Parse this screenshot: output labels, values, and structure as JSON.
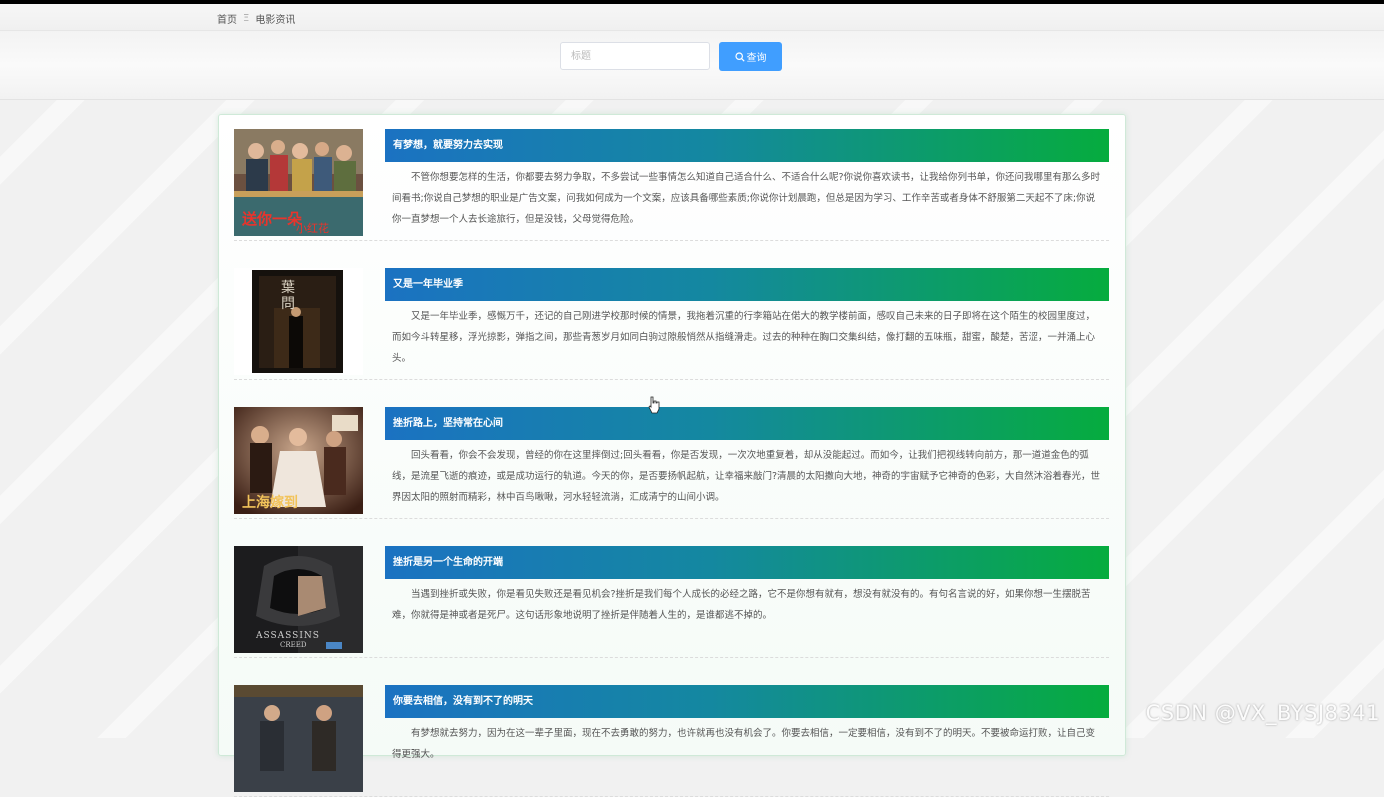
{
  "breadcrumb": {
    "home": "首页",
    "separator": "Ξ",
    "current": "电影资讯"
  },
  "search": {
    "placeholder": "标题",
    "value": "",
    "button_label": "查询",
    "button_icon": "search-icon"
  },
  "articles": [
    {
      "title": "有梦想，就要努力去实现",
      "text": "不管你想要怎样的生活，你都要去努力争取，不多尝试一些事情怎么知道自己适合什么、不适合什么呢?你说你喜欢读书，让我给你列书单，你还问我哪里有那么多时间看书;你说自己梦想的职业是广告文案，问我如何成为一个文案，应该具备哪些素质;你说你计划晨跑，但总是因为学习、工作辛苦或者身体不舒服第二天起不了床;你说你一直梦想一个人去长途旅行，但是没钱，父母觉得危险。",
      "poster_caption": "送你一朵小红花"
    },
    {
      "title": "又是一年毕业季",
      "text": "又是一年毕业季，感慨万千，还记的自己刚进学校那时候的情景，我拖着沉重的行李箱站在偌大的教学楼前面，感叹自己未来的日子即将在这个陌生的校园里度过，而如今斗转星移，浮光掠影，弹指之间，那些青葱岁月如同白驹过隙般悄然从指缝滑走。过去的种种在胸口交集纠结，像打翻的五味瓶，甜蜜，酸楚，苦涩，一并涌上心头。",
      "poster_caption": "葉問"
    },
    {
      "title": "挫折路上，坚持常在心间",
      "text": "回头看看，你会不会发现，曾经的你在这里摔倒过;回头看看，你是否发现，一次次地重复着，却从没能起过。而如今，让我们把视线转向前方，那一道道金色的弧线，是流星飞逝的痕迹，或是成功运行的轨道。今天的你，是否要扬帆起航，让幸福来敲门?清晨的太阳撒向大地，神奇的宇宙赋予它神奇的色彩，大自然沐浴着春光，世界因太阳的照射而精彩，林中百鸟啾啾，河水轻轻流淌，汇成清宁的山间小调。",
      "poster_caption": "上海嫁到"
    },
    {
      "title": "挫折是另一个生命的开端",
      "text": "当遇到挫折或失败，你是看见失败还是看见机会?挫折是我们每个人成长的必经之路，它不是你想有就有，想没有就没有的。有句名言说的好，如果你想一生摆脱苦难，你就得是神或者是死尸。这句话形象地说明了挫折是伴随着人生的，是谁都逃不掉的。",
      "poster_caption": "ASSASSINS CREED"
    },
    {
      "title": "你要去相信，没有到不了的明天",
      "text": "有梦想就去努力，因为在这一辈子里面，现在不去勇敢的努力，也许就再也没有机会了。你要去相信，一定要相信，没有到不了的明天。不要被命运打败，让自己变得更强大。",
      "poster_caption": ""
    }
  ],
  "watermark": "CSDN @VX_BYSJ8341",
  "colors": {
    "title_gradient_start": "#1b72c2",
    "title_gradient_end": "#06ac3e",
    "search_button": "#409eff"
  }
}
